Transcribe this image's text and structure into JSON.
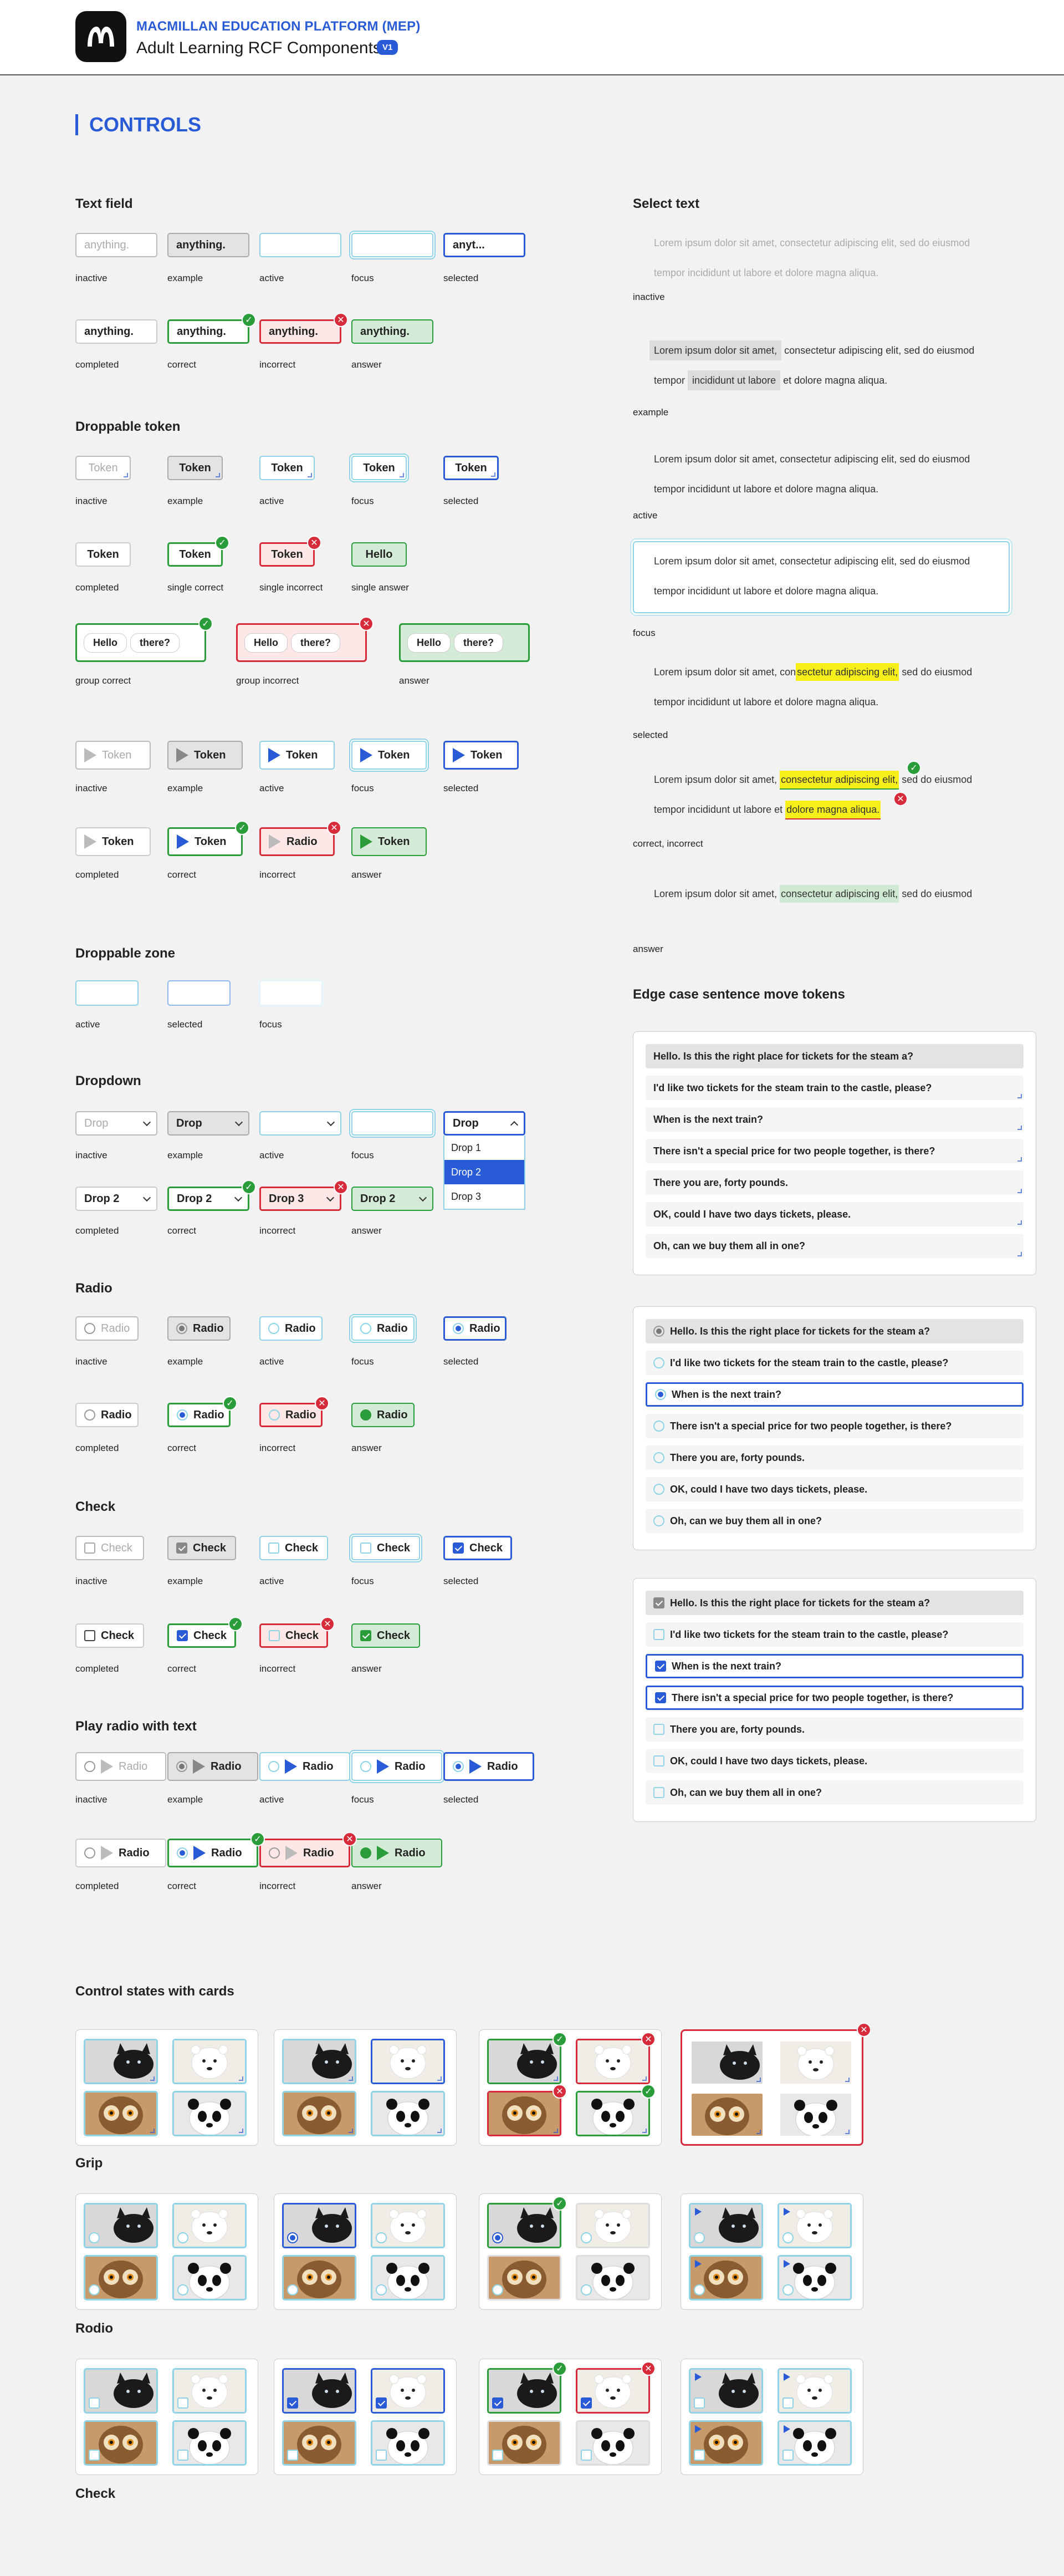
{
  "header": {
    "org": "MACMILLAN EDUCATION PLATFORM (MEP)",
    "title": "Adult Learning RCF Components",
    "version": "V1"
  },
  "section_title": "CONTROLS",
  "text_field": {
    "title": "Text field",
    "row1": [
      {
        "value": "anything.",
        "label": "inactive"
      },
      {
        "value": "anything.",
        "label": "example"
      },
      {
        "value": "",
        "label": "active"
      },
      {
        "value": "",
        "label": "focus"
      },
      {
        "value": "anyt...",
        "label": "selected"
      }
    ],
    "row2": [
      {
        "value": "anything.",
        "label": "completed"
      },
      {
        "value": "anything.",
        "label": "correct"
      },
      {
        "value": "anything.",
        "label": "incorrect"
      },
      {
        "value": "anything.",
        "label": "answer"
      }
    ]
  },
  "droppable_token": {
    "title": "Droppable token",
    "row1": [
      {
        "value": "Token",
        "label": "inactive"
      },
      {
        "value": "Token",
        "label": "example"
      },
      {
        "value": "Token",
        "label": "active"
      },
      {
        "value": "Token",
        "label": "focus"
      },
      {
        "value": "Token",
        "label": "selected"
      }
    ],
    "row2": [
      {
        "value": "Token",
        "label": "completed"
      },
      {
        "value": "Token",
        "label": "single correct"
      },
      {
        "value": "Token",
        "label": "single incorrect"
      },
      {
        "value": "Hello",
        "label": "single answer"
      }
    ],
    "groups": [
      {
        "a": "Hello",
        "b": "there?",
        "label": "group correct"
      },
      {
        "a": "Hello",
        "b": "there?",
        "label": "group incorrect"
      },
      {
        "a": "Hello",
        "b": "there?",
        "label": "answer"
      }
    ],
    "play1": [
      {
        "value": "Token",
        "label": "inactive"
      },
      {
        "value": "Token",
        "label": "example"
      },
      {
        "value": "Token",
        "label": "active"
      },
      {
        "value": "Token",
        "label": "focus"
      },
      {
        "value": "Token",
        "label": "selected"
      }
    ],
    "play2": [
      {
        "value": "Token",
        "label": "completed"
      },
      {
        "value": "Token",
        "label": "correct"
      },
      {
        "value": "Radio",
        "label": "incorrect"
      },
      {
        "value": "Token",
        "label": "answer"
      }
    ]
  },
  "droppable_zone": {
    "title": "Droppable zone",
    "items": [
      {
        "label": "active"
      },
      {
        "label": "selected"
      },
      {
        "label": "focus"
      }
    ]
  },
  "dropdown": {
    "title": "Dropdown",
    "row1": [
      {
        "value": "Drop",
        "label": "inactive"
      },
      {
        "value": "Drop",
        "label": "example"
      },
      {
        "value": "",
        "label": "active"
      },
      {
        "value": "",
        "label": "focus"
      },
      {
        "value": "Drop",
        "label": "selected"
      }
    ],
    "options": [
      "Drop 1",
      "Drop 2",
      "Drop 3"
    ],
    "row2": [
      {
        "value": "Drop 2",
        "label": "completed"
      },
      {
        "value": "Drop 2",
        "label": "correct"
      },
      {
        "value": "Drop 3",
        "label": "incorrect"
      },
      {
        "value": "Drop 2",
        "label": "answer"
      }
    ]
  },
  "radio": {
    "title": "Radio",
    "row1": [
      {
        "value": "Radio",
        "label": "inactive"
      },
      {
        "value": "Radio",
        "label": "example"
      },
      {
        "value": "Radio",
        "label": "active"
      },
      {
        "value": "Radio",
        "label": "focus"
      },
      {
        "value": "Radio",
        "label": "selected"
      }
    ],
    "row2": [
      {
        "value": "Radio",
        "label": "completed"
      },
      {
        "value": "Radio",
        "label": "correct"
      },
      {
        "value": "Radio",
        "label": "incorrect"
      },
      {
        "value": "Radio",
        "label": "answer"
      }
    ]
  },
  "check": {
    "title": "Check",
    "row1": [
      {
        "value": "Check",
        "label": "inactive"
      },
      {
        "value": "Check",
        "label": "example"
      },
      {
        "value": "Check",
        "label": "active"
      },
      {
        "value": "Check",
        "label": "focus"
      },
      {
        "value": "Check",
        "label": "selected"
      }
    ],
    "row2": [
      {
        "value": "Check",
        "label": "completed"
      },
      {
        "value": "Check",
        "label": "correct"
      },
      {
        "value": "Check",
        "label": "incorrect"
      },
      {
        "value": "Check",
        "label": "answer"
      }
    ]
  },
  "play_radio": {
    "title": "Play radio with text",
    "row1": [
      {
        "value": "Radio",
        "label": "inactive"
      },
      {
        "value": "Radio",
        "label": "example"
      },
      {
        "value": "Radio",
        "label": "active"
      },
      {
        "value": "Radio",
        "label": "focus"
      },
      {
        "value": "Radio",
        "label": "selected"
      }
    ],
    "row2": [
      {
        "value": "Radio",
        "label": "completed"
      },
      {
        "value": "Radio",
        "label": "correct"
      },
      {
        "value": "Radio",
        "label": "incorrect"
      },
      {
        "value": "Radio",
        "label": "answer"
      }
    ]
  },
  "select_text": {
    "title": "Select text",
    "line1a": "Lorem ipsum dolor sit amet, ",
    "line1b": "consectetur adipiscing elit,",
    "line1c": " sed do eiusmod",
    "line2a": "tempor incididunt ut labore et ",
    "line2b": "dolore magna aliqua.",
    "ex1": "Lorem ipsum dolor sit amet,",
    "ex1b": " consectetur adipiscing elit, sed do eiusmod",
    "ex2a": "tempor ",
    "ex2b": "incididunt ut labore",
    "ex2c": " et dolore magna aliqua.",
    "full1": "Lorem ipsum dolor sit amet, consectetur adipiscing elit, sed do eiusmod",
    "full2": "tempor incididunt ut labore et dolore magna aliqua.",
    "sel1a": "Lorem ipsum dolor sit amet, con",
    "sel1b": "sectetur adipiscing elit,",
    "labels": {
      "inactive": "inactive",
      "example": "example",
      "active": "active",
      "focus": "focus",
      "selected": "selected",
      "ci": "correct, incorrect",
      "answer": "answer"
    }
  },
  "edge_case": {
    "title": "Edge case sentence move tokens",
    "sentences": [
      "Hello. Is this the right place for tickets for the steam a?",
      "I'd like two tickets for the steam train to the castle, please?",
      "When is the next train?",
      "There isn't a special price for two people together, is there?",
      "There you are, forty pounds.",
      "OK, could I have two days tickets, please.",
      "Oh, can we buy them all in one?"
    ]
  },
  "cards": {
    "title": "Control states with cards",
    "grip": "Grip",
    "radio": "Rodio",
    "check": "Check"
  },
  "colors": {
    "accent": "#2a5bd7",
    "cyan": "#8fd3e6",
    "correct": "#2a9d3a",
    "incorrect": "#d62b3a",
    "highlight": "#f7ef1a"
  }
}
